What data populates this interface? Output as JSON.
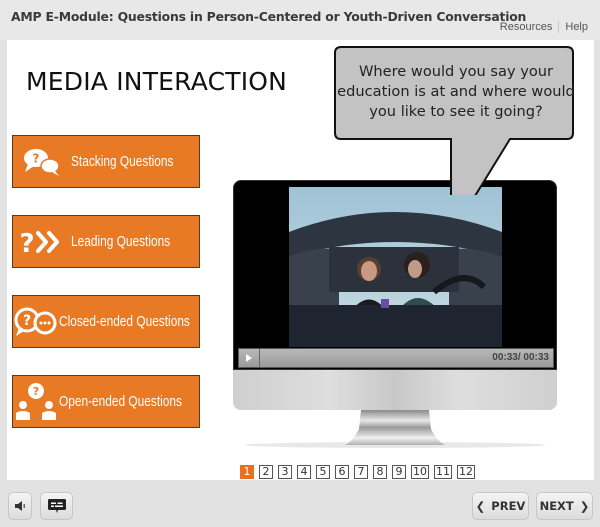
{
  "header": {
    "title": "AMP E-Module: Questions in Person-Centered or Youth-Driven Conversation",
    "links": [
      "Resources",
      "Help"
    ]
  },
  "slide": {
    "title": "MEDIA INTERACTION",
    "buttons": [
      {
        "label": "Stacking Questions",
        "icon": "chat-question-bubbles-icon"
      },
      {
        "label": "Leading Questions",
        "icon": "question-chevrons-icon"
      },
      {
        "label": "Closed-ended Questions",
        "icon": "question-ellipsis-bubbles-icon"
      },
      {
        "label": "Open-ended Questions",
        "icon": "people-question-icon"
      }
    ],
    "speech_bubble": "Where would you say your education is at and where would you like to see it going?",
    "video": {
      "time": "00:33/ 00:33",
      "progress": 1.0
    }
  },
  "pager": {
    "pages": [
      "1",
      "2",
      "3",
      "4",
      "5",
      "6",
      "7",
      "8",
      "9",
      "10",
      "11",
      "12"
    ],
    "current": "1"
  },
  "footer": {
    "prev_label": "PREV",
    "next_label": "NEXT"
  },
  "colors": {
    "accent": "#e87a26",
    "page_active": "#e8701f"
  }
}
